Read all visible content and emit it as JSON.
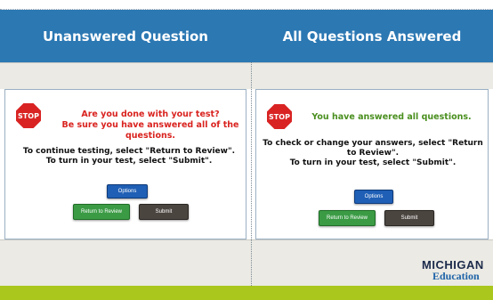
{
  "columns": {
    "left_title": "Unanswered Question",
    "right_title": "All Questions Answered"
  },
  "left_panel": {
    "stop_text": "STOP",
    "alert_line1": "Are you done with your test?",
    "alert_line2": "Be sure you have answered all of the questions.",
    "instruction_line1": "To continue testing, select \"Return to Review\".",
    "instruction_line2": "To turn in your test, select \"Submit\".",
    "options_label": "Options",
    "review_label": "Return to Review",
    "submit_label": "Submit"
  },
  "right_panel": {
    "stop_text": "STOP",
    "alert_line1": "You have answered all questions.",
    "instruction_line1": "To check or change your answers, select \"Return",
    "instruction_line2": "to Review\".",
    "instruction_line3": "To turn in your test, select \"Submit\".",
    "options_label": "Options",
    "review_label": "Return to Review",
    "submit_label": "Submit"
  },
  "logo": {
    "top_text": "MICHIGAN",
    "bottom_text": "Education"
  },
  "colors": {
    "header_blue": "#2b78b3",
    "footer_green": "#a9c71d",
    "alert_red": "#d9231f",
    "alert_green": "#4a8f1f"
  }
}
